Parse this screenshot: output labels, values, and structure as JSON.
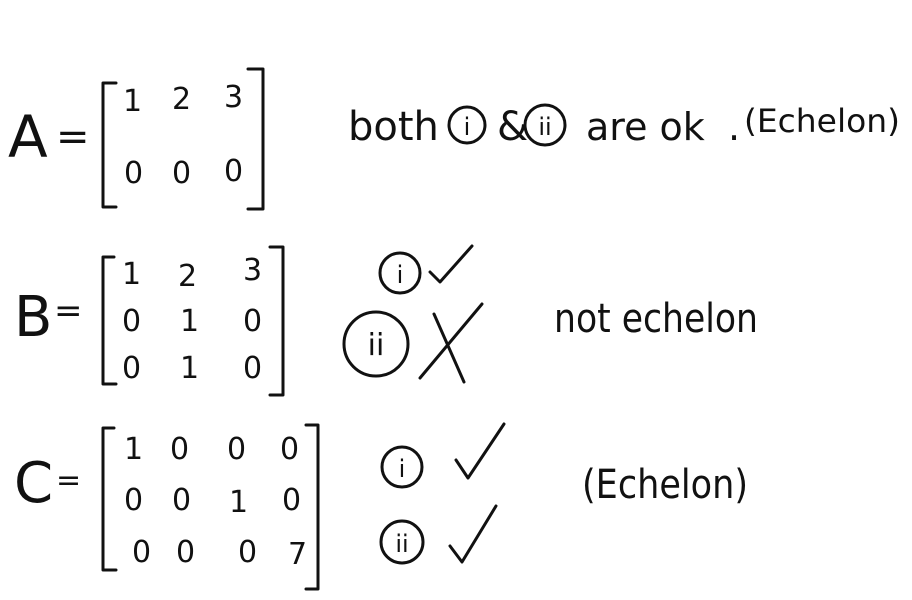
{
  "matrices": [
    {
      "name": "A",
      "equals": "=",
      "rows": [
        [
          "1",
          "2",
          "3"
        ],
        [
          "0",
          "0",
          "0"
        ]
      ],
      "comment": {
        "prefix": "both",
        "first_mark": "i",
        "joiner": "&",
        "second_mark": "ii",
        "suffix": "are ok",
        "dot": ".",
        "verdict": "(Echelon)"
      }
    },
    {
      "name": "B",
      "equals": "=",
      "rows": [
        [
          "1",
          "2",
          "3"
        ],
        [
          "0",
          "1",
          "0"
        ],
        [
          "0",
          "1",
          "0"
        ]
      ],
      "checks": [
        {
          "mark": "i",
          "result": "pass"
        },
        {
          "mark": "ii",
          "result": "fail"
        }
      ],
      "verdict": "not echelon"
    },
    {
      "name": "C",
      "equals": "=",
      "rows": [
        [
          "1",
          "0",
          "0",
          "0"
        ],
        [
          "0",
          "0",
          "1",
          "0"
        ],
        [
          "0",
          "0",
          "0",
          "7"
        ]
      ],
      "checks": [
        {
          "mark": "i",
          "result": "pass"
        },
        {
          "mark": "ii",
          "result": "pass"
        }
      ],
      "verdict": "(Echelon)"
    }
  ],
  "ink_color": "#111111"
}
